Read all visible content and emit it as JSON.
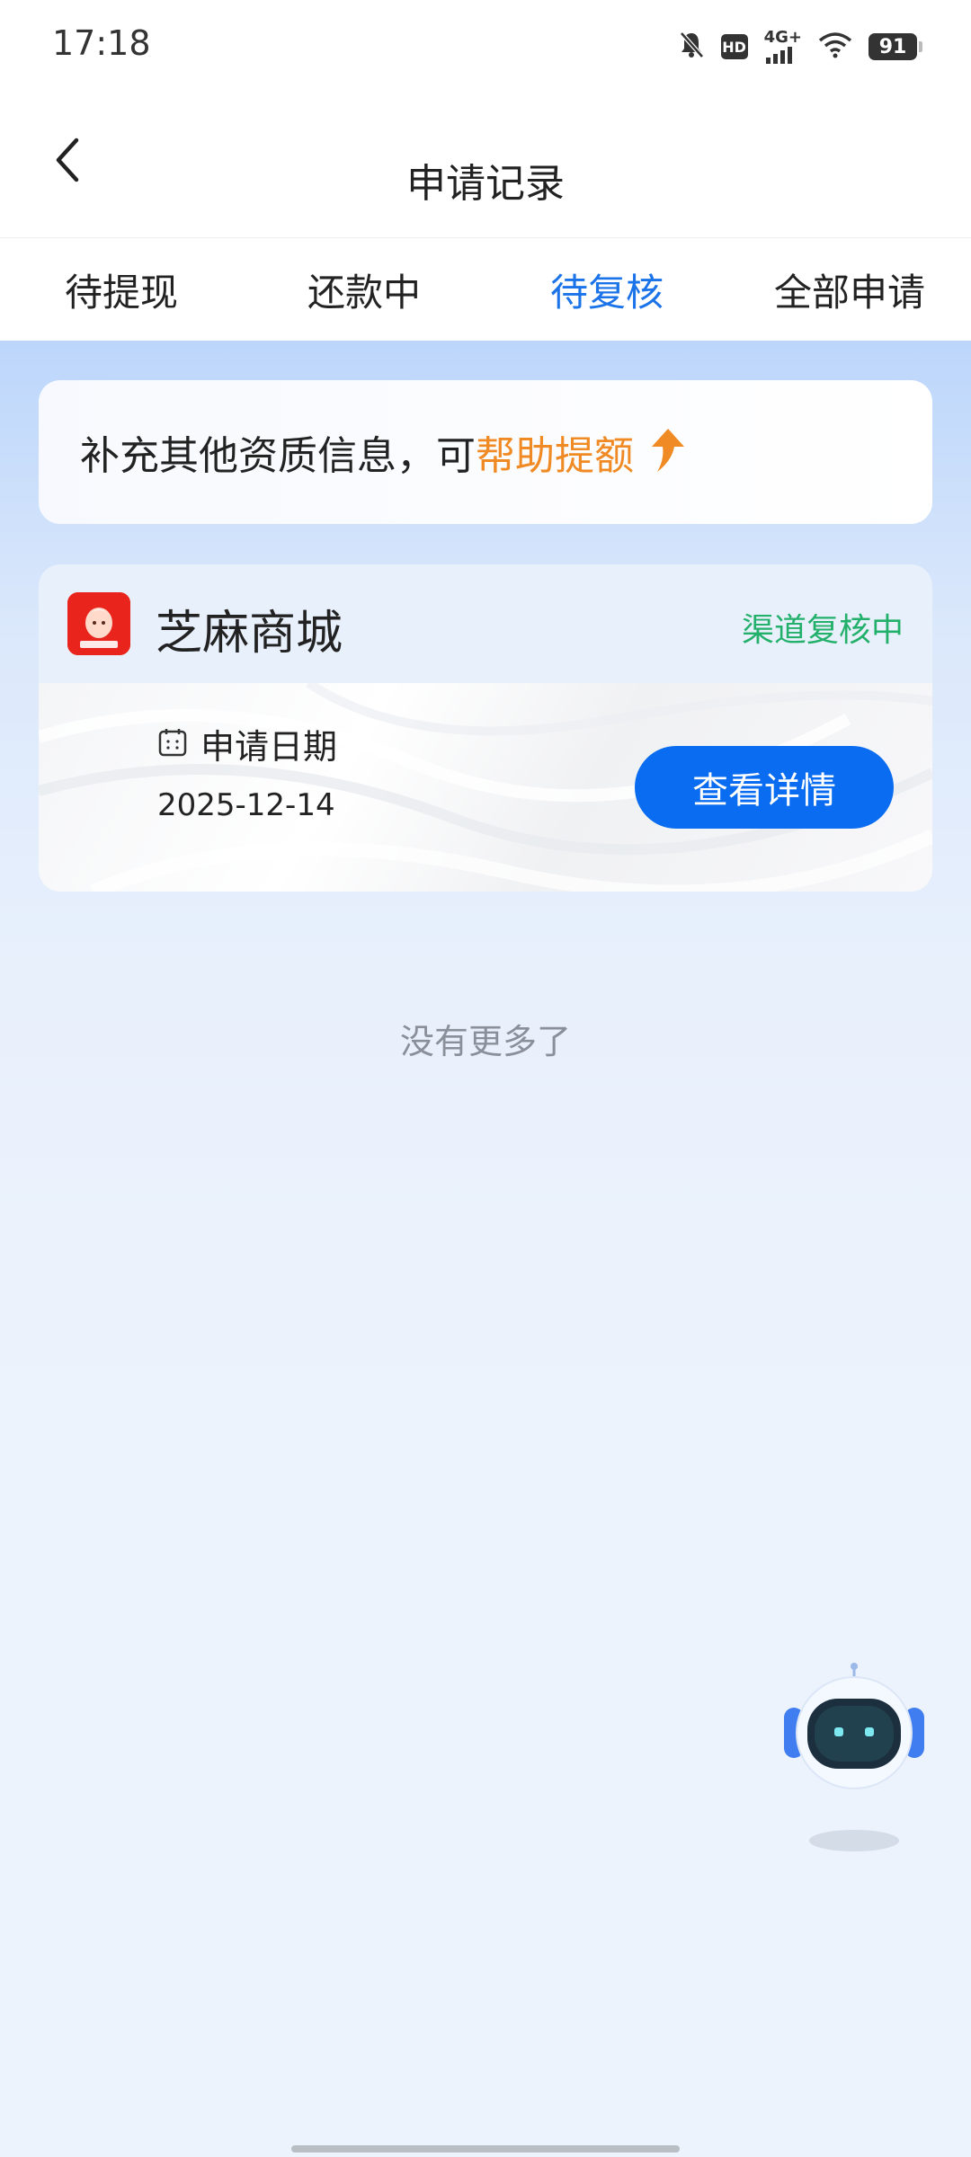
{
  "status_bar": {
    "time": "17:18",
    "network": "4G+",
    "hd": "HD",
    "battery": "91"
  },
  "nav": {
    "title": "申请记录",
    "back_icon": "chevron-left-icon"
  },
  "tabs": [
    {
      "label": "待提现",
      "active": false
    },
    {
      "label": "还款中",
      "active": false
    },
    {
      "label": "待复核",
      "active": true
    },
    {
      "label": "全部申请",
      "active": false
    }
  ],
  "banner": {
    "text": "补充其他资质信息，可",
    "highlight": "帮助提额",
    "icon": "arrow-up-icon"
  },
  "application": {
    "app_name": "芝麻商城",
    "status": "渠道复核中",
    "date_label": "申请日期",
    "date": "2025-12-14",
    "detail_button": "查看详情"
  },
  "footer": {
    "no_more": "没有更多了"
  },
  "colors": {
    "accent": "#1a73e8",
    "button": "#0a6cf0",
    "highlight": "#f08a24",
    "status_green": "#23b06a"
  }
}
